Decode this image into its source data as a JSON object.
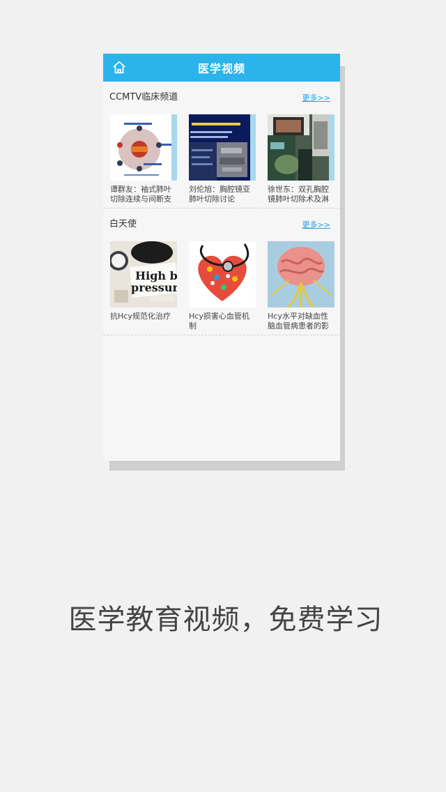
{
  "app": {
    "title": "医学视频"
  },
  "sections": [
    {
      "title": "CCMTV临床频道",
      "more": "更多>>",
      "items": [
        {
          "caption": "谭群友：袖式肺叶切除连续与间断支",
          "thumb": "slide-diagram"
        },
        {
          "caption": "刘伦旭：胸腔镜亚肺叶切除讨论",
          "thumb": "ct-scan-slide"
        },
        {
          "caption": "徐世东：双孔胸腔镜肺叶切除术及淋",
          "thumb": "surgery-room"
        }
      ]
    },
    {
      "title": "白天使",
      "more": "更多>>",
      "items": [
        {
          "caption": "抗Hcy规范化治疗",
          "thumb": "blood-pressure"
        },
        {
          "caption": "Hcy损害心血管机制",
          "thumb": "stethoscope-pills"
        },
        {
          "caption": "Hcy水平对缺血性脑血管病患者的影",
          "thumb": "brain-nerves"
        }
      ]
    }
  ],
  "thumb_text": {
    "hbp_line1": "High blo",
    "hbp_line2": "pressure"
  },
  "tagline": "医学教育视频，免费学习",
  "colors": {
    "accent": "#2bb3ec",
    "link": "#2a9be0",
    "background": "#f1f1f1"
  }
}
